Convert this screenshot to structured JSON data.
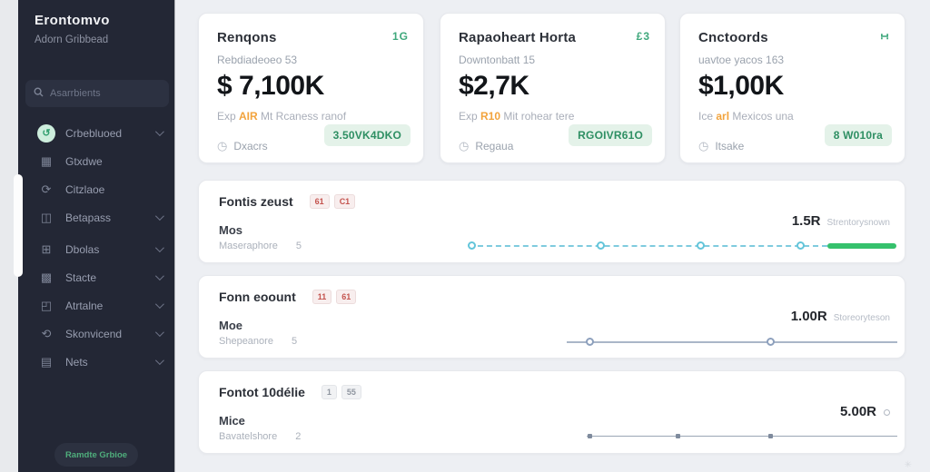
{
  "sidebar": {
    "brand_title": "Erontomvo",
    "brand_subtitle": "Adorn Gribbead",
    "search_placeholder": "Asarrbients",
    "items": [
      {
        "label": "Crbebluoed"
      },
      {
        "label": "Gtxdwe"
      },
      {
        "label": "Citzlaoe"
      },
      {
        "label": "Betapass"
      },
      {
        "label": "Dbolas"
      },
      {
        "label": "Stacte"
      },
      {
        "label": "Atrtalne"
      },
      {
        "label": "Skonvicend"
      },
      {
        "label": "Nets"
      }
    ],
    "footer_button_label": "Ramdte Grbioe"
  },
  "stat_cards": [
    {
      "title": "Renqons",
      "corner_icon": "1G",
      "subtitle": "Rebdiadeoeo 53",
      "value": "$ 7,100K",
      "note_prefix": "Exp ",
      "note_highlight": "AIR",
      "note_suffix": " Mt Rcaness ranof",
      "footer_label": "Dxacrs",
      "badge": "3.50VK4DKO"
    },
    {
      "title": "Rapaoheart Horta",
      "corner_icon": "£3",
      "subtitle": "Downtonbatt 15",
      "value": "$2,7K",
      "note_prefix": "Exp ",
      "note_highlight": "R10",
      "note_suffix": " Mit rohear tere",
      "footer_label": "Regaua",
      "badge": "RGOIVR61O"
    },
    {
      "title": "Cnctoords",
      "corner_icon": "∺",
      "subtitle": "uavtoe yacos 163",
      "value": "$1,00K",
      "note_prefix": "Ice ",
      "note_highlight": "arl",
      "note_suffix": " Mexicos una",
      "footer_label": "Itsake",
      "badge": "8 W010ra"
    }
  ],
  "rows": [
    {
      "title": "Fontis zeust",
      "chips": [
        "61",
        "C1"
      ],
      "label": "Mos",
      "sub_label": "Maseraphore",
      "sub_value": "5",
      "value": "1.5R",
      "value_note": "Strentorysnown"
    },
    {
      "title": "Fonn eoount",
      "chips": [
        "11",
        "61"
      ],
      "label": "Moe",
      "sub_label": "Shepeanore",
      "sub_value": "5",
      "value": "1.00R",
      "value_note": "Storeoryteson"
    },
    {
      "title": "Fontot 10délie",
      "chips": [
        "1",
        "55"
      ],
      "label": "Mice",
      "sub_label": "Bavatelshore",
      "sub_value": "2",
      "value": "5.00R",
      "value_note": ""
    }
  ],
  "icons": {
    "dashboard": "↺",
    "orders": "▦",
    "refresh": "⟳",
    "catalog": "◫",
    "grid": "⊞",
    "boxes": "▩",
    "frame": "◰",
    "sync": "⟲",
    "menu": "▤",
    "clock": "◷",
    "sparkle": "✳"
  },
  "colors": {
    "sidebar_bg": "#232735",
    "main_bg": "#edeff3",
    "card_bg": "#ffffff",
    "accent_green": "#2e8f63",
    "badge_bg": "#e4f2e9",
    "progress_green": "#35c16c",
    "slider_cyan": "#7fcbde",
    "highlight_orange": "#f2a33c",
    "chip_red": "#c4534e"
  }
}
